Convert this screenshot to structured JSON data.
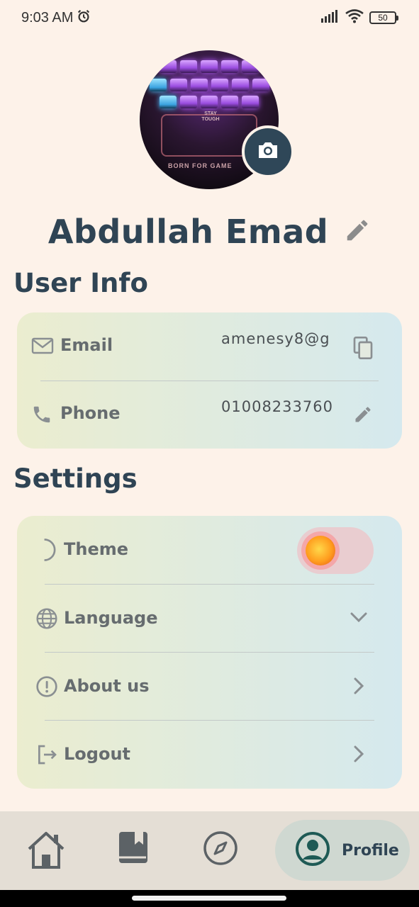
{
  "status_bar": {
    "time": "9:03 AM",
    "battery": "50"
  },
  "profile": {
    "name": "Abdullah Emad"
  },
  "user_info": {
    "title": "User Info",
    "email_label": "Email",
    "email_value": "amenesy8@g",
    "phone_label": "Phone",
    "phone_value": "01008233760"
  },
  "settings": {
    "title": "Settings",
    "theme_label": "Theme",
    "language_label": "Language",
    "about_label": "About us",
    "logout_label": "Logout"
  },
  "avatar_image": {
    "top_text": "STAY TOUGH",
    "bottom_text": "BORN FOR GAME"
  },
  "bottom_nav": {
    "items": [
      "home-icon",
      "book-icon",
      "compass-icon",
      "profile-icon"
    ],
    "active_label": "Profile"
  },
  "colors": {
    "background": "#fdf2e9",
    "primary": "#2f4454",
    "card_left": "#ebedcf",
    "card_right": "#d5e9ee",
    "nav_background": "#e4ded5",
    "nav_active": "#cfd8d1"
  }
}
